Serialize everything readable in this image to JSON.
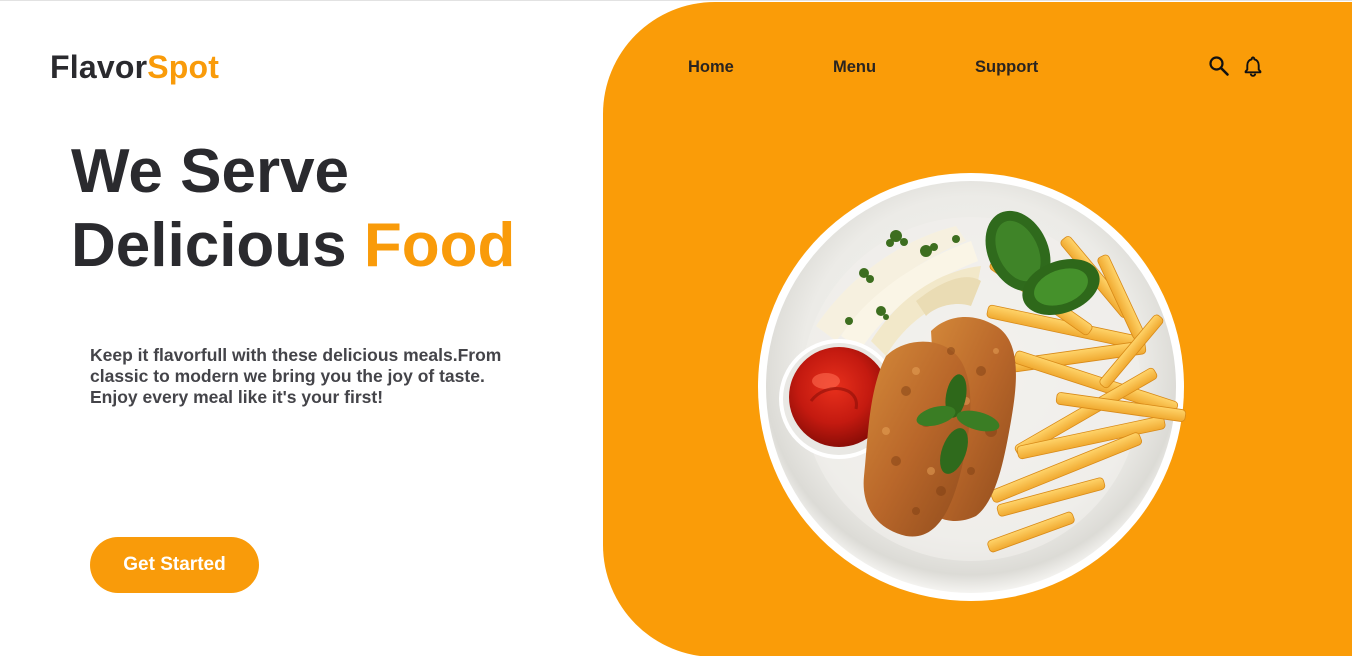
{
  "brand": {
    "part1": "Flavor",
    "part2": "Spot",
    "dark_color": "#2a2a2e",
    "accent_color": "#f99b0a"
  },
  "nav": {
    "items": [
      {
        "label": "Home"
      },
      {
        "label": "Menu"
      },
      {
        "label": "Support"
      }
    ],
    "icons": [
      "search-icon",
      "bell-icon"
    ]
  },
  "hero": {
    "line1": "We Serve",
    "line2": "Delicious ",
    "accent_word": "Food",
    "description": "Keep it flavorfull with these delicious meals.From classic to modern we bring you the joy of taste. Enjoy every meal like it's your first!",
    "cta_label": "Get Started"
  },
  "image": {
    "name": "plate-of-fried-chicken-fries-ketchup"
  },
  "colors": {
    "panel": "#fa9c08",
    "button": "#f99b0a",
    "text": "#2a2a2e"
  }
}
